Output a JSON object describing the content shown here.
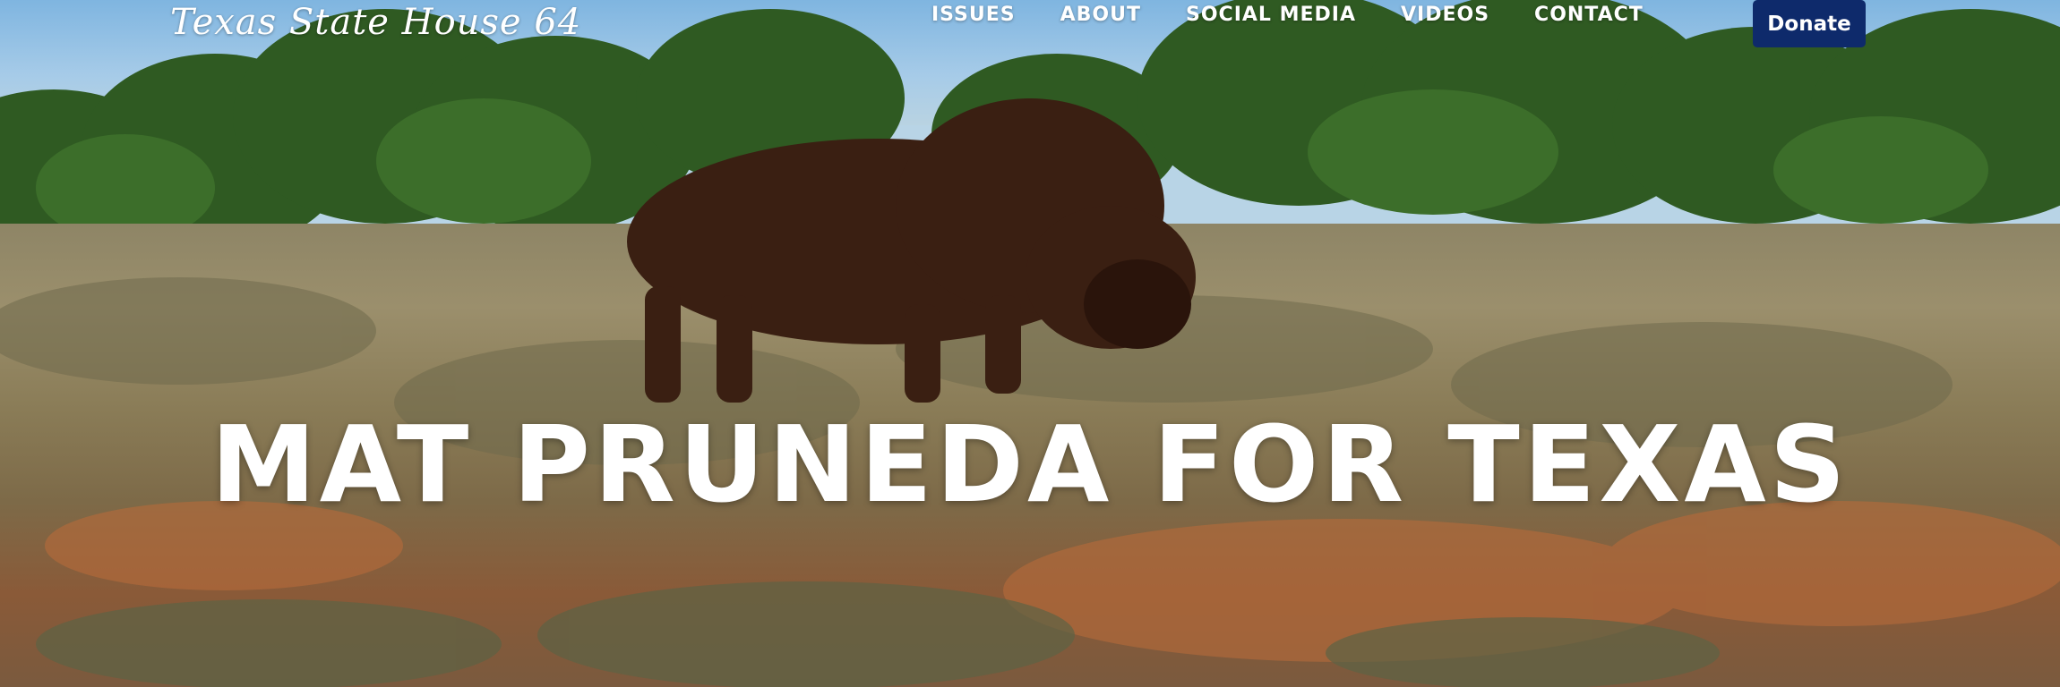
{
  "header": {
    "site_title": "Texas State House 64",
    "nav": [
      {
        "label": "ISSUES"
      },
      {
        "label": "ABOUT"
      },
      {
        "label": "SOCIAL MEDIA"
      },
      {
        "label": "VIDEOS"
      },
      {
        "label": "CONTACT"
      }
    ],
    "donate_label": "Donate"
  },
  "hero": {
    "headline": "MAT PRUNEDA FOR TEXAS",
    "background_subject": "bison grazing in prairie"
  },
  "colors": {
    "donate_bg": "#0e2a6b",
    "text": "#ffffff"
  }
}
